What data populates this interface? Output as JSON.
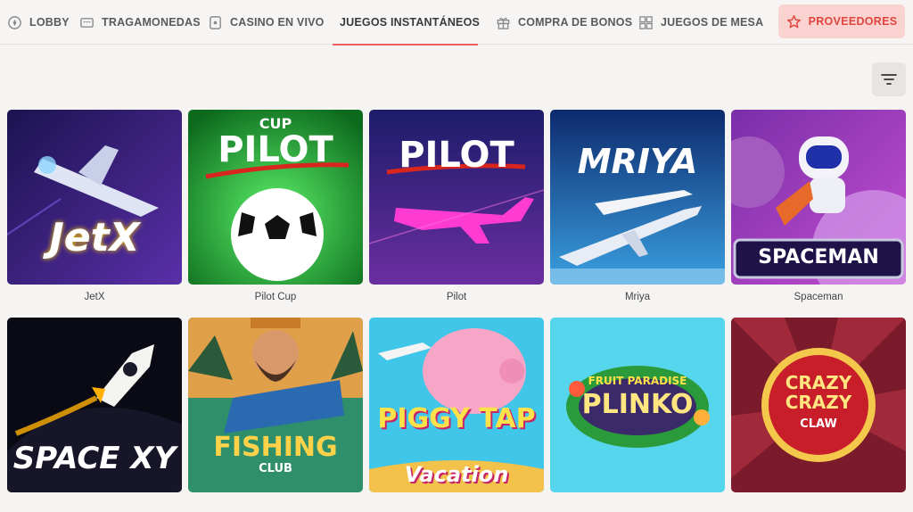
{
  "nav": {
    "items": [
      {
        "label": "LOBBY",
        "icon": "compass-icon"
      },
      {
        "label": "TRAGAMONEDAS",
        "icon": "slot-machine-icon"
      },
      {
        "label": "CASINO EN VIVO",
        "icon": "live-dealer-icon"
      },
      {
        "label": "JUEGOS INSTANTÁNEOS",
        "icon": "lightning-icon",
        "active": true
      },
      {
        "label": "COMPRA DE BONOS",
        "icon": "gift-icon"
      },
      {
        "label": "JUEGOS DE MESA",
        "icon": "grid-icon"
      }
    ],
    "providers_label": "PROVEEDORES"
  },
  "filter": {
    "icon": "filter-icon"
  },
  "colors": {
    "accent": "#ea5f5f",
    "provider_bg": "#fad2d0",
    "provider_text": "#e0453f"
  },
  "games": [
    {
      "title": "JetX",
      "logo": "JetX"
    },
    {
      "title": "Pilot Cup",
      "logo_top": "CUP",
      "logo": "PILOT"
    },
    {
      "title": "Pilot",
      "logo": "PILOT"
    },
    {
      "title": "Mriya",
      "logo": "MRIYA"
    },
    {
      "title": "Spaceman",
      "logo": "SPACEMAN"
    },
    {
      "title": "",
      "logo": "SPACE XY"
    },
    {
      "title": "",
      "logo": "FISHING",
      "logo_sub": "CLUB"
    },
    {
      "title": "",
      "logo": "PIGGY TAP",
      "logo_sub": "Vacation"
    },
    {
      "title": "",
      "logo_top": "FRUIT PARADISE",
      "logo": "PLINKO"
    },
    {
      "title": "",
      "logo": "CRAZY CRAZY",
      "logo_sub": "CLAW"
    }
  ]
}
